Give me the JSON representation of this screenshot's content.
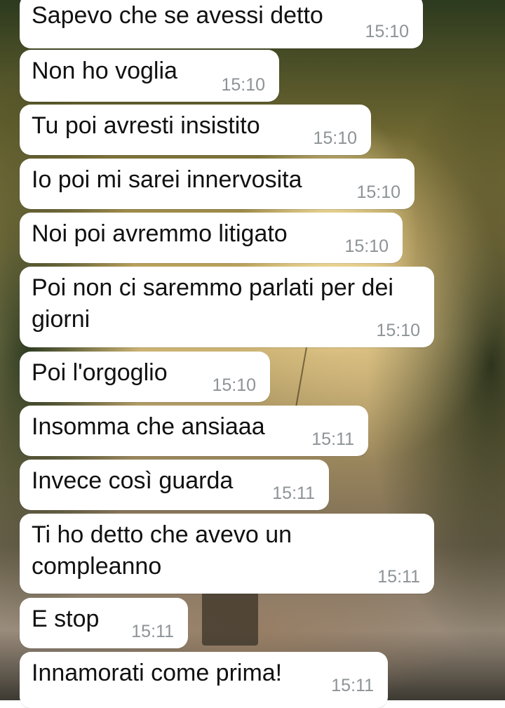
{
  "messages": [
    {
      "text": "Sapevo che se avessi detto",
      "time": "15:10"
    },
    {
      "text": "Non ho voglia",
      "time": "15:10"
    },
    {
      "text": "Tu poi avresti insistito",
      "time": "15:10"
    },
    {
      "text": "Io poi mi sarei innervosita",
      "time": "15:10"
    },
    {
      "text": "Noi poi avremmo litigato",
      "time": "15:10"
    },
    {
      "text": "Poi non ci saremmo parlati per dei",
      "text2": "giorni",
      "time": "15:10"
    },
    {
      "text": "Poi l'orgoglio",
      "time": "15:10"
    },
    {
      "text": "Insomma che ansiaaa",
      "time": "15:11"
    },
    {
      "text": "Invece così guarda",
      "time": "15:11"
    },
    {
      "text": "Ti ho detto che avevo un",
      "text2": "compleanno",
      "time": "15:11"
    },
    {
      "text": "E stop",
      "time": "15:11"
    },
    {
      "text": "Innamorati come prima!",
      "time": "15:11"
    }
  ]
}
